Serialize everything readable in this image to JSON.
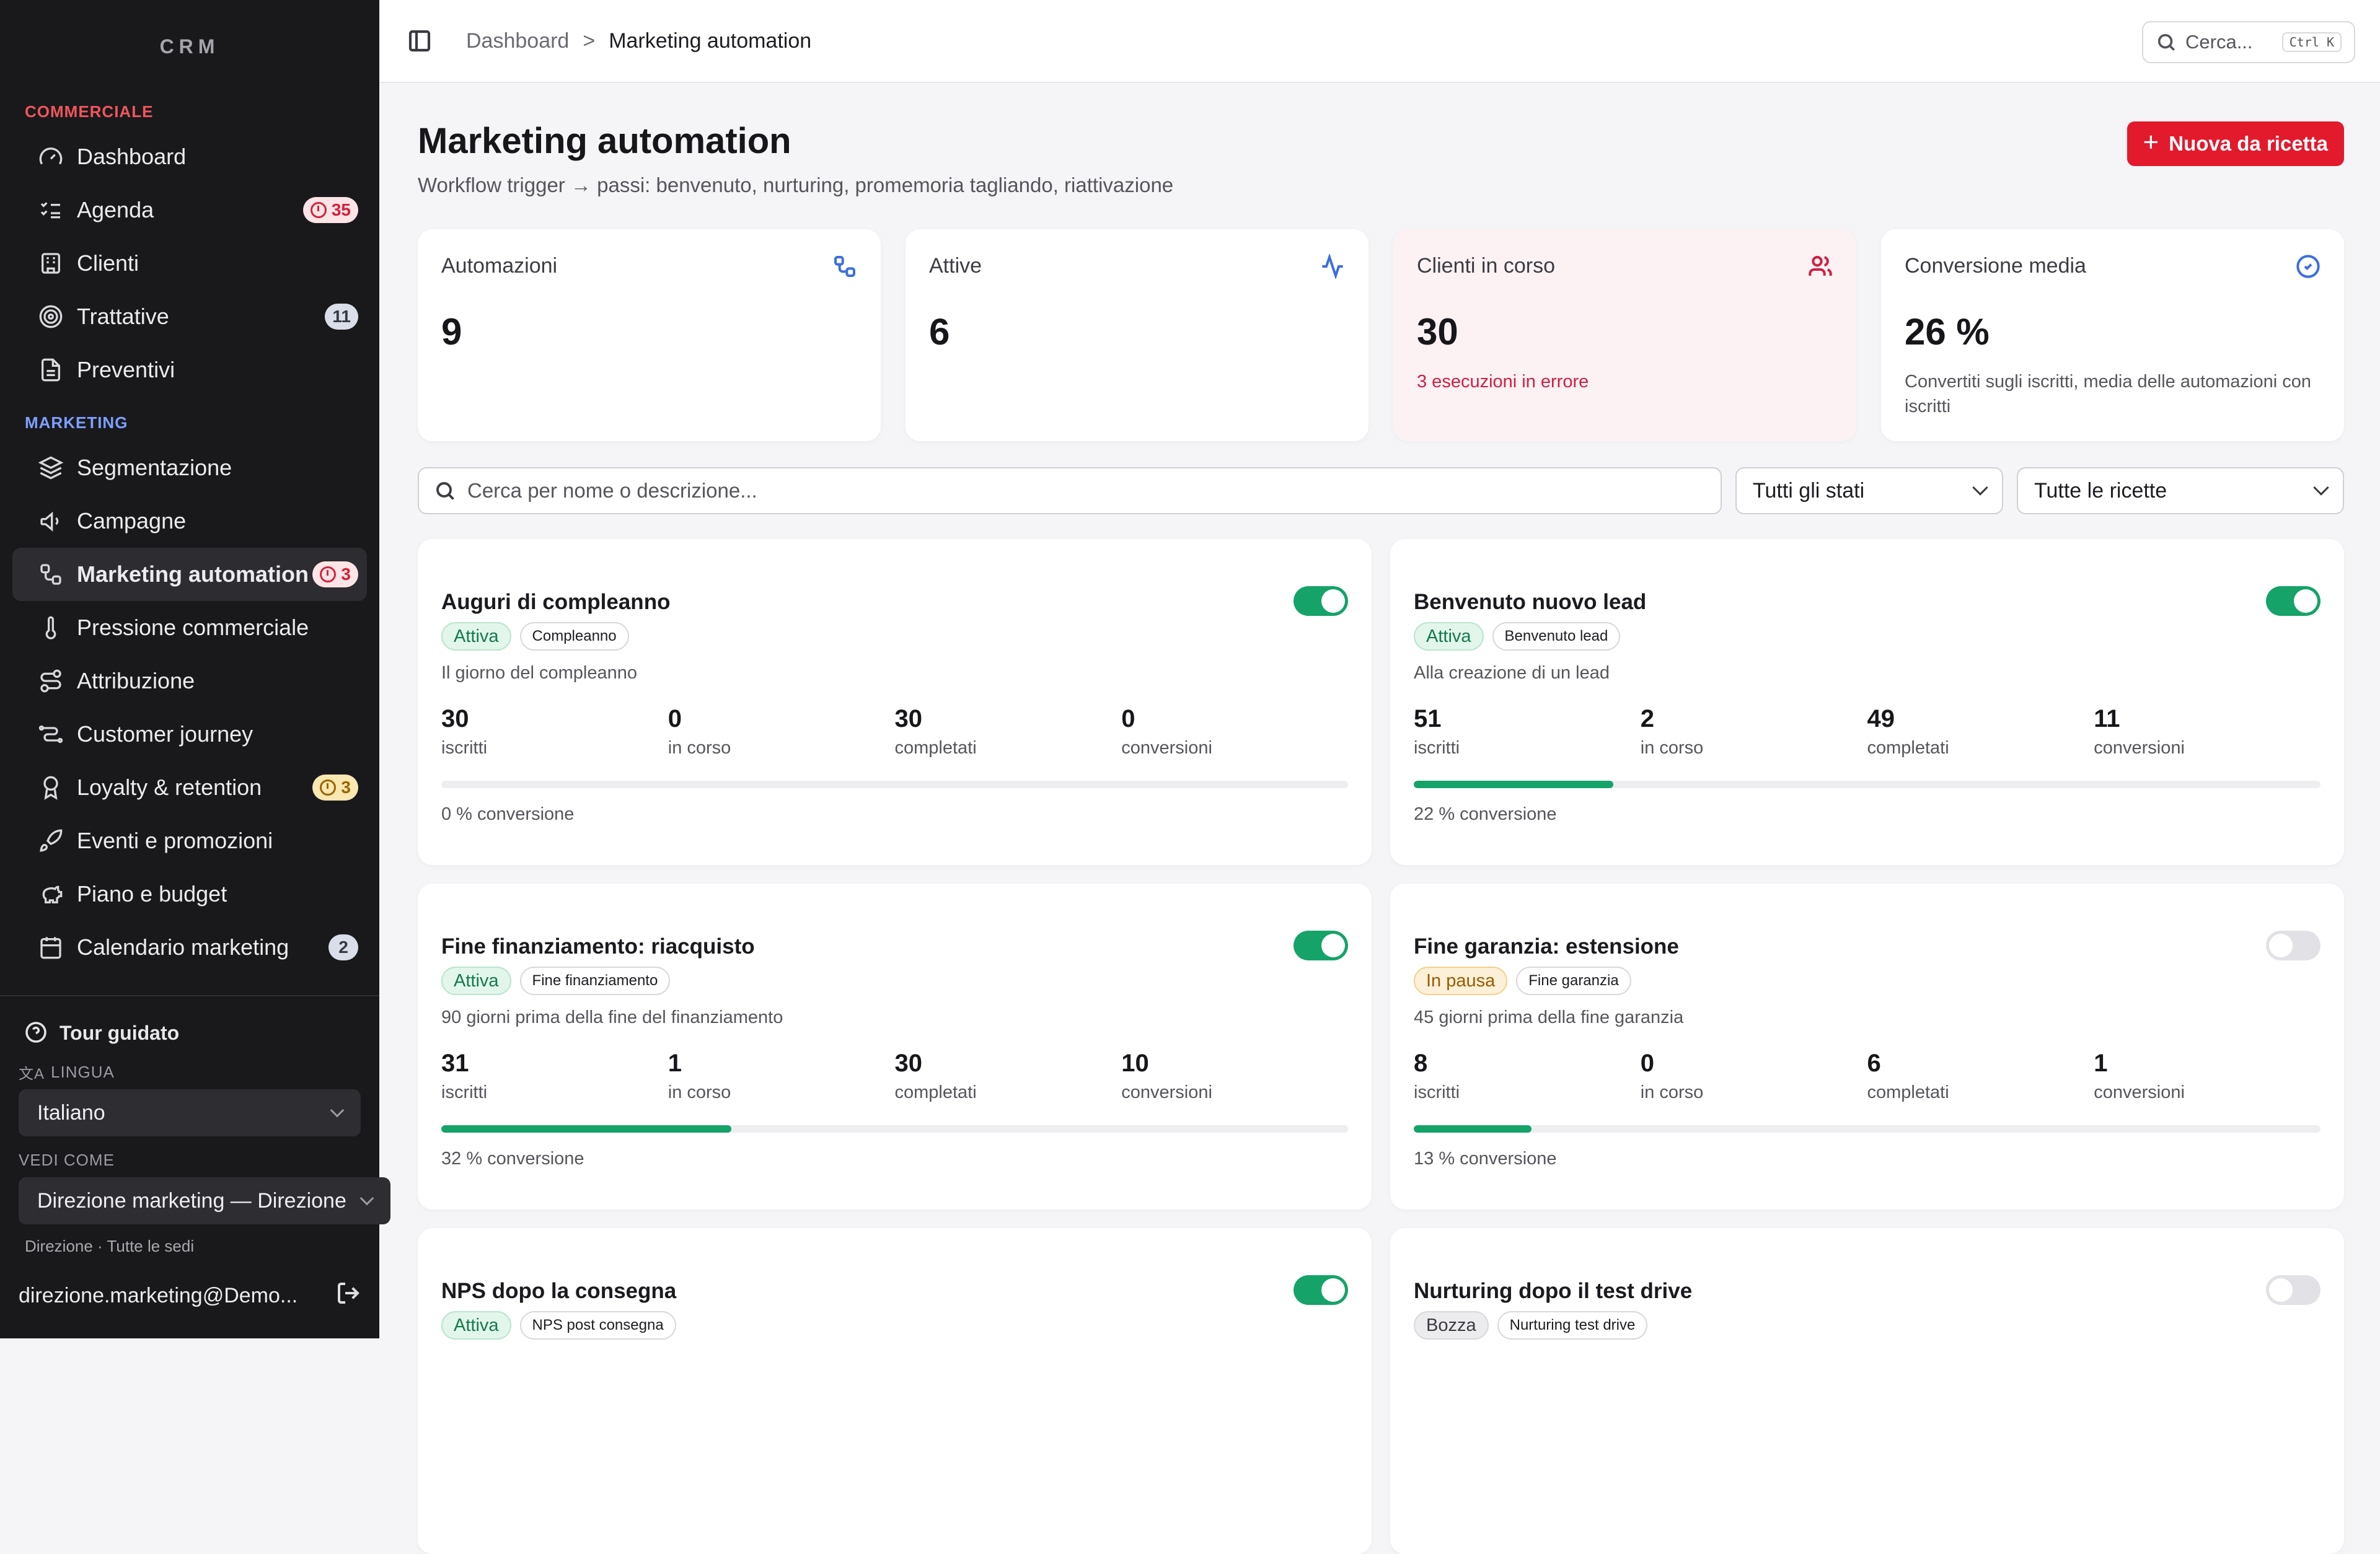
{
  "brand": "CRM",
  "sidebar": {
    "section_commerciale": "COMMERCIALE",
    "commerciale_items": [
      {
        "label": "Dashboard",
        "icon": "gauge-icon",
        "badge": null
      },
      {
        "label": "Agenda",
        "icon": "list-checks-icon",
        "badge": "35",
        "badge_type": "pink"
      },
      {
        "label": "Clienti",
        "icon": "building-icon",
        "badge": null
      },
      {
        "label": "Trattative",
        "icon": "target-icon",
        "badge": "11",
        "badge_type": "slate"
      },
      {
        "label": "Preventivi",
        "icon": "file-text-icon",
        "badge": null
      }
    ],
    "section_marketing": "MARKETING",
    "marketing_items": [
      {
        "label": "Segmentazione",
        "icon": "layers-icon",
        "badge": null
      },
      {
        "label": "Campagne",
        "icon": "megaphone-icon",
        "badge": null
      },
      {
        "label": "Marketing automation",
        "icon": "workflow-icon",
        "badge": "3",
        "badge_type": "pink",
        "active": true
      },
      {
        "label": "Pressione commerciale",
        "icon": "thermometer-icon",
        "badge": null
      },
      {
        "label": "Attribuzione",
        "icon": "route-icon",
        "badge": null
      },
      {
        "label": "Customer journey",
        "icon": "journey-icon",
        "badge": null
      },
      {
        "label": "Loyalty & retention",
        "icon": "award-icon",
        "badge": "3",
        "badge_type": "amber"
      },
      {
        "label": "Eventi e promozioni",
        "icon": "rocket-icon",
        "badge": null
      },
      {
        "label": "Piano e budget",
        "icon": "piggy-bank-icon",
        "badge": null
      },
      {
        "label": "Calendario marketing",
        "icon": "calendar-icon",
        "badge": "2",
        "badge_type": "slate"
      }
    ],
    "tour_label": "Tour guidato",
    "lingua_label": "LINGUA",
    "lingua_value": "Italiano",
    "vedi_come_label": "VEDI COME",
    "vedi_come_value": "Direzione marketing — Direzione",
    "scope_info": "Direzione · Tutte le sedi",
    "user_email": "direzione.marketing@Demo..."
  },
  "topbar": {
    "breadcrumb_root": "Dashboard",
    "breadcrumb_sep": ">",
    "breadcrumb_current": "Marketing automation",
    "search_label": "Cerca...",
    "search_kbd": "Ctrl K"
  },
  "header": {
    "title": "Marketing automation",
    "subtitle": "Workflow trigger → passi: benvenuto, nurturing, promemoria tagliando, riattivazione",
    "new_button": "Nuova da ricetta"
  },
  "stats": [
    {
      "label": "Automazioni",
      "value": "9",
      "note": "",
      "icon": "workflow-icon",
      "icon_color": "#3b6fe0"
    },
    {
      "label": "Attive",
      "value": "6",
      "note": "",
      "icon": "activity-icon",
      "icon_color": "#3b6fe0"
    },
    {
      "label": "Clienti in corso",
      "value": "30",
      "note": "3 esecuzioni in errore",
      "icon": "users-icon",
      "icon_color": "#d01f43"
    },
    {
      "label": "Conversione media",
      "value": "26 %",
      "note": "Convertiti sugli iscritti, media delle automazioni con iscritti",
      "icon": "check-circle-icon",
      "icon_color": "#3b6fe0"
    }
  ],
  "filters": {
    "search_placeholder": "Cerca per nome o descrizione...",
    "status_value": "Tutti gli stati",
    "recipe_value": "Tutte le ricette"
  },
  "metric_labels": {
    "iscritti": "iscritti",
    "in_corso": "in corso",
    "completati": "completati",
    "conversioni": "conversioni"
  },
  "automations": [
    {
      "title": "Auguri di compleanno",
      "status": "Attiva",
      "status_type": "green",
      "recipe": "Compleanno",
      "trigger": "Il giorno del compleanno",
      "enabled": true,
      "iscritti": "30",
      "in_corso": "0",
      "completati": "30",
      "conversioni": "0",
      "conversion_pct": 0,
      "conversion_text": "0 % conversione"
    },
    {
      "title": "Benvenuto nuovo lead",
      "status": "Attiva",
      "status_type": "green",
      "recipe": "Benvenuto lead",
      "trigger": "Alla creazione di un lead",
      "enabled": true,
      "iscritti": "51",
      "in_corso": "2",
      "completati": "49",
      "conversioni": "11",
      "conversion_pct": 22,
      "conversion_text": "22 % conversione"
    },
    {
      "title": "Fine finanziamento: riacquisto",
      "status": "Attiva",
      "status_type": "green",
      "recipe": "Fine finanziamento",
      "trigger": "90 giorni prima della fine del finanziamento",
      "enabled": true,
      "iscritti": "31",
      "in_corso": "1",
      "completati": "30",
      "conversioni": "10",
      "conversion_pct": 32,
      "conversion_text": "32 % conversione"
    },
    {
      "title": "Fine garanzia: estensione",
      "status": "In pausa",
      "status_type": "amber",
      "recipe": "Fine garanzia",
      "trigger": "45 giorni prima della fine garanzia",
      "enabled": false,
      "iscritti": "8",
      "in_corso": "0",
      "completati": "6",
      "conversioni": "1",
      "conversion_pct": 13,
      "conversion_text": "13 % conversione"
    },
    {
      "title": "NPS dopo la consegna",
      "status": "Attiva",
      "status_type": "green",
      "recipe": "NPS post consegna",
      "enabled": true
    },
    {
      "title": "Nurturing dopo il test drive",
      "status": "Bozza",
      "status_type": "gray",
      "recipe": "Nurturing test drive",
      "enabled": false
    }
  ]
}
